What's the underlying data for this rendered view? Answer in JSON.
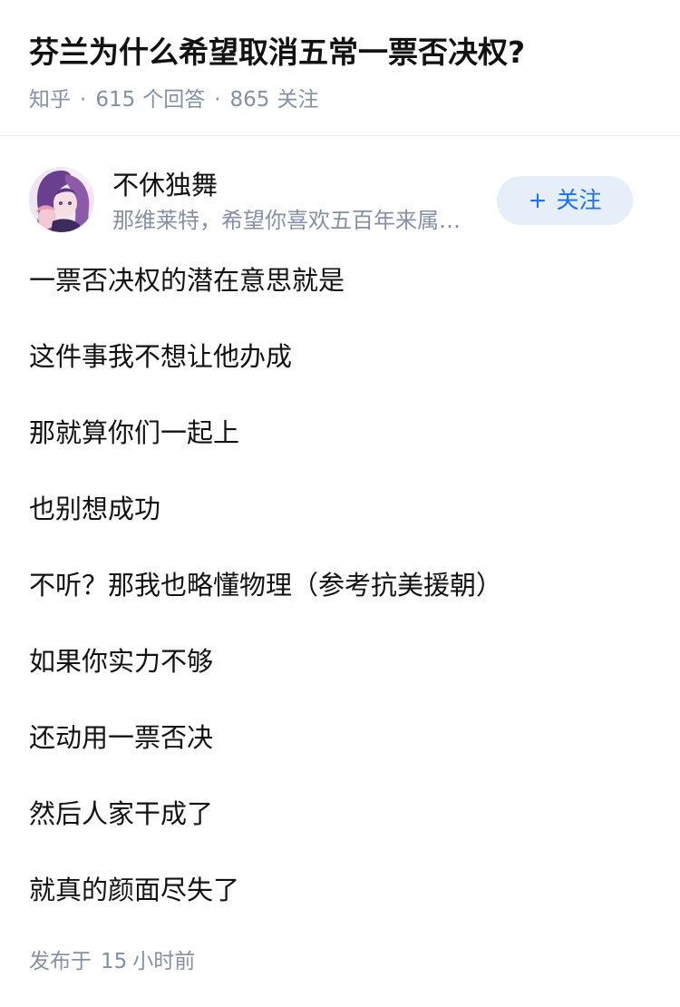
{
  "question": {
    "title": "芬兰为什么希望取消五常一票否决权?",
    "source": "知乎",
    "answers_count": "615",
    "answers_label": "个回答",
    "followers_count": "865",
    "followers_label": "关注"
  },
  "author": {
    "name": "不休独舞",
    "bio": "那维莱特，希望你喜欢五百年来属…",
    "follow_label": "关注",
    "follow_icon": "plus-icon"
  },
  "answer": {
    "lines": [
      "一票否决权的潜在意思就是",
      "这件事我不想让他办成",
      "那就算你们一起上",
      "也别想成功",
      "不听？那我也略懂物理（参考抗美援朝）",
      "如果你实力不够",
      "还动用一票否决",
      "然后人家干成了",
      "就真的颜面尽失了"
    ],
    "published_prefix": "发布于",
    "published_num": "15",
    "published_suffix": "小时前"
  },
  "colors": {
    "text": "#121212",
    "meta": "#8590a6",
    "accent": "#1772f6",
    "follow_bg": "#e5eef9"
  }
}
